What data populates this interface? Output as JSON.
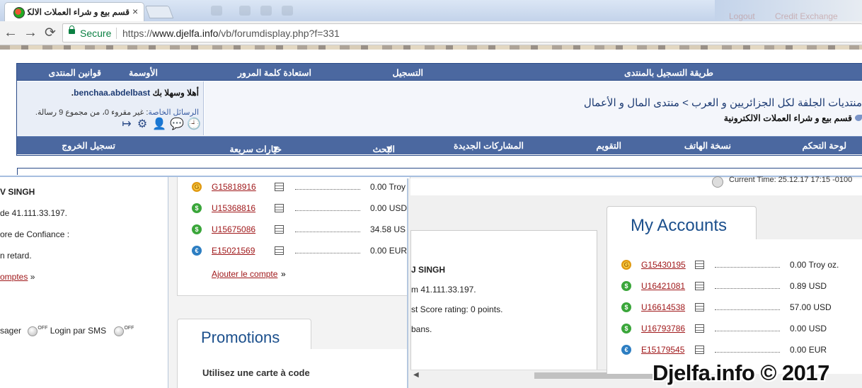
{
  "browser": {
    "tab_title": "قسم بيع و شراء العملات الالكترو",
    "tab_close": "×",
    "secure_label": "Secure",
    "url_prefix": "https://",
    "url_host": "www.djelfa.info",
    "url_path": "/vb/forumdisplay.php?f=331",
    "back": "←",
    "forward": "→",
    "reload": "⟳",
    "ghost_texts": [
      "Logout",
      "Credit Exchange"
    ]
  },
  "forum": {
    "top_nav": [
      "طريقة التسجيل بالمنتدى",
      "التسجيل",
      "استعادة كلمة المرور",
      "الأوسمة",
      "قوانين المنتدى"
    ],
    "welcome_prefix": "أهلا وسهلا بك",
    "username": "benchaa.abdelbast",
    "pm_label": "الرسائل الخاصة",
    "pm_text": ": غير مقروء 0، من مجموع 9 رسالة.",
    "breadcrumb": "منتديات الجلفة لكل الجزائريين و العرب > منتدى المال و الأعمال",
    "current_forum": "قسم بيع و شراء العملات الالكترونية",
    "bottom_nav": {
      "control_panel": "لوحة التحكم",
      "mobile": "نسخة الهاتف",
      "calendar": "التقويم",
      "new_posts": "المشاركات الجديدة",
      "search": "البحث",
      "quick_links": "خيارات سريعة",
      "logout": "تسجيل الخروج"
    },
    "icons": [
      "clock-icon",
      "logout-icon",
      "settings-icon",
      "add-user-icon",
      "chat-icon"
    ]
  },
  "left_window": {
    "lines": [
      "V SINGH",
      "de 41.111.33.197.",
      "ore de Confiance :",
      "n retard."
    ],
    "link": "omptes",
    "link_suffix": "»",
    "sms_prefix": "sager",
    "sms_label": "Login par SMS",
    "toggle_off": "OFF",
    "accounts": [
      {
        "coin": "G",
        "type": "gold",
        "id": "G15818916",
        "balance": "0.00 Troy"
      },
      {
        "coin": "$",
        "type": "usd",
        "id": "U15368816",
        "balance": "0.00 USD"
      },
      {
        "coin": "$",
        "type": "usd",
        "id": "U15675086",
        "balance": "34.58 US"
      },
      {
        "coin": "€",
        "type": "eur",
        "id": "E15021569",
        "balance": "0.00 EUR"
      }
    ],
    "add_account": "Ajouter le compte",
    "add_account_suffix": "»",
    "promotions_title": "Promotions",
    "promotions_sub": "Utilisez une carte à code"
  },
  "right_window": {
    "current_time": "Current Time: 25.12.17 17:15 -0100",
    "inner_lines": [
      "J SINGH",
      "m 41.111.33.197.",
      "st Score rating: 0 points.",
      "bans."
    ],
    "my_accounts_title": "My Accounts",
    "accounts": [
      {
        "coin": "G",
        "type": "gold",
        "id": "G15430195",
        "balance": "0.00 Troy oz."
      },
      {
        "coin": "$",
        "type": "usd",
        "id": "U16421081",
        "balance": "0.89 USD"
      },
      {
        "coin": "$",
        "type": "usd",
        "id": "U16614538",
        "balance": "57.00 USD"
      },
      {
        "coin": "$",
        "type": "usd",
        "id": "U16793786",
        "balance": "0.00 USD"
      },
      {
        "coin": "€",
        "type": "eur",
        "id": "E15179545",
        "balance": "0.00 EUR"
      }
    ]
  },
  "watermark": "Djelfa.info © 2017",
  "colors": {
    "forum_nav": "#4b68a0",
    "account_link": "#a0191b",
    "title_blue": "#1b4f8c",
    "secure_green": "#0b8043"
  }
}
